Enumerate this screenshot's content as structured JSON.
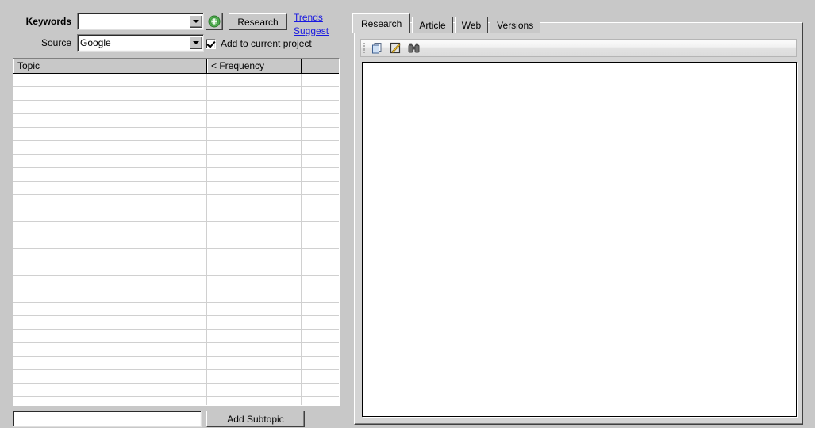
{
  "left": {
    "keywords_label": "Keywords",
    "source_label": "Source",
    "keywords_value": "",
    "keywords_placeholder": "",
    "source_value": "Google",
    "source_options": [
      "Google"
    ],
    "add_button_icon": "add-circle-green-icon",
    "research_button": "Research",
    "links": {
      "trends": "Trends",
      "suggest": "Suggest"
    },
    "checkbox": {
      "label": "Add to current project",
      "checked": true
    },
    "grid": {
      "columns": [
        "Topic",
        "< Frequency",
        ""
      ],
      "rows": [],
      "row_count": 25
    },
    "subtopic_input_value": "",
    "add_subtopic_button": "Add Subtopic"
  },
  "right": {
    "tabs": [
      {
        "label": "Research",
        "active": true
      },
      {
        "label": "Article",
        "active": false
      },
      {
        "label": "Web",
        "active": false
      },
      {
        "label": "Versions",
        "active": false
      }
    ],
    "toolbar": {
      "buttons": [
        {
          "name": "copy-icon",
          "title": "Copy"
        },
        {
          "name": "edit-note-icon",
          "title": "Edit"
        },
        {
          "name": "binoculars-find-icon",
          "title": "Find"
        }
      ]
    },
    "content_text": ""
  },
  "colors": {
    "window_bg": "#c8c8c8",
    "panel_bg": "#d4d4d4",
    "link": "#1a1ae0",
    "field_bg": "#ffffff",
    "accent_green": "#3faa3f"
  }
}
